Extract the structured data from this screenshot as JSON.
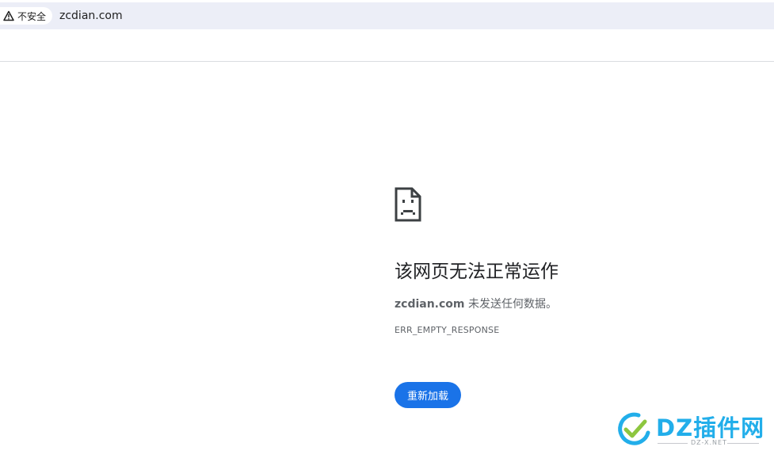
{
  "browser": {
    "security_label": "不安全",
    "url": "zcdian.com"
  },
  "error_page": {
    "heading": "该网页无法正常运作",
    "host": "zcdian.com",
    "message": " 未发送任何数据。",
    "error_code": "ERR_EMPTY_RESPONSE",
    "reload_label": "重新加载"
  },
  "watermark": {
    "title": "DZ插件网",
    "subtitle": "DZ-X.NET"
  },
  "colors": {
    "omnibox_bg": "#eceef7",
    "reload_button": "#1a73e8",
    "watermark_blue": "#22aeea",
    "watermark_green": "#8dc63f"
  },
  "icons": {
    "security": "warning-triangle-icon",
    "error": "sad-document-icon"
  }
}
